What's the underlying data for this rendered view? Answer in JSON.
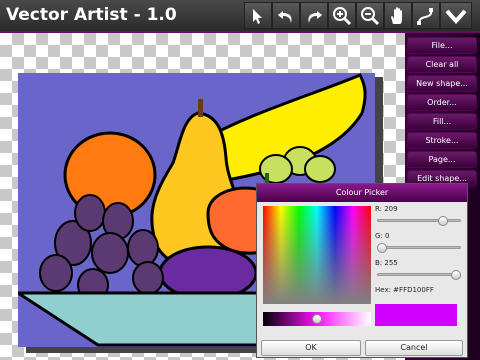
{
  "app": {
    "title": "Vector Artist - 1.0"
  },
  "toolbar": {
    "tools": [
      "pointer-icon",
      "undo-icon",
      "redo-icon",
      "zoom-in-icon",
      "zoom-out-icon",
      "hand-icon",
      "path-edit-icon",
      "collapse-icon"
    ]
  },
  "sidebar": {
    "items": [
      {
        "label": "File..."
      },
      {
        "label": "Clear all"
      },
      {
        "label": "New shape..."
      },
      {
        "label": "Order..."
      },
      {
        "label": "Fill..."
      },
      {
        "label": "Stroke..."
      },
      {
        "label": "Page..."
      },
      {
        "label": "Edit shape..."
      }
    ]
  },
  "colour_picker": {
    "title": "Colour Picker",
    "r_label": "R: 209",
    "g_label": "G: 0",
    "b_label": "B: 255",
    "r": 209,
    "g": 0,
    "b": 255,
    "hex_label": "Hex: #FFD100FF",
    "swatch_color": "#D100FF",
    "brightness_level": 0.5,
    "ok_label": "OK",
    "cancel_label": "Cancel"
  },
  "colors": {
    "accent": "#6b0a6b",
    "background_panel": "#6a65c8",
    "bowl": "#8fcfcf"
  }
}
